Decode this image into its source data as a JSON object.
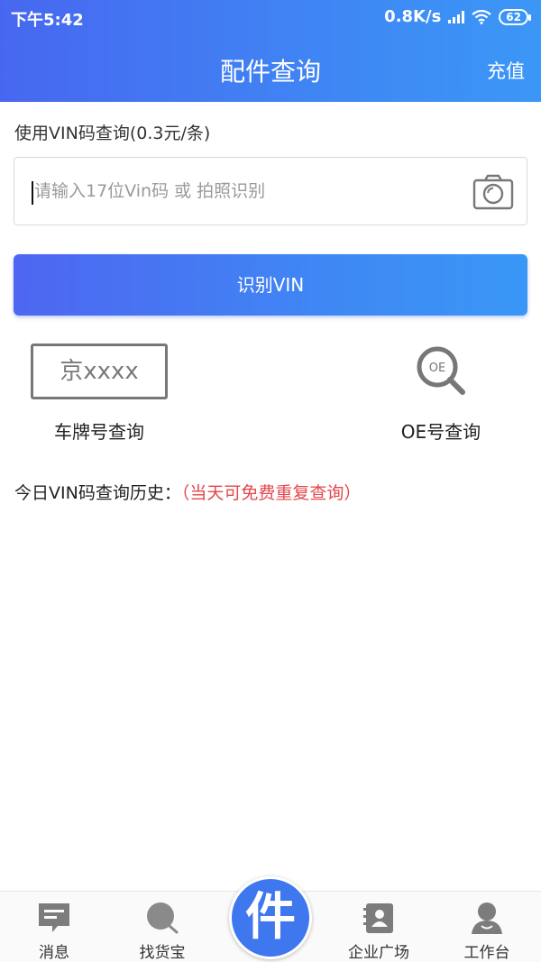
{
  "status": {
    "time": "下午5:42",
    "speed": "0.8K/s",
    "battery": "62"
  },
  "nav": {
    "title": "配件查询",
    "right_action": "充值"
  },
  "vin": {
    "label": "使用VIN码查询(0.3元/条)",
    "placeholder": "请输入17位Vin码 或 拍照识别",
    "value": "",
    "button": "识别VIN"
  },
  "quick": {
    "plate_sample": "京xxxx",
    "plate_label": "车牌号查询",
    "oe_icon_text": "OE",
    "oe_label": "OE号查询"
  },
  "history": {
    "label": "今日VIN码查询历史：",
    "note": "（当天可免费重复查询）"
  },
  "tabbar": {
    "center_label": "件",
    "tabs": [
      {
        "label": "消息",
        "icon": "message-icon"
      },
      {
        "label": "找货宝",
        "icon": "search-icon"
      },
      {
        "label": "企业广场",
        "icon": "contacts-icon"
      },
      {
        "label": "工作台",
        "icon": "user-icon"
      }
    ]
  },
  "colors": {
    "primary": "#3f78ee",
    "header_start": "#4767f0",
    "header_end": "#3b97f6",
    "note_red": "#e2474b"
  }
}
